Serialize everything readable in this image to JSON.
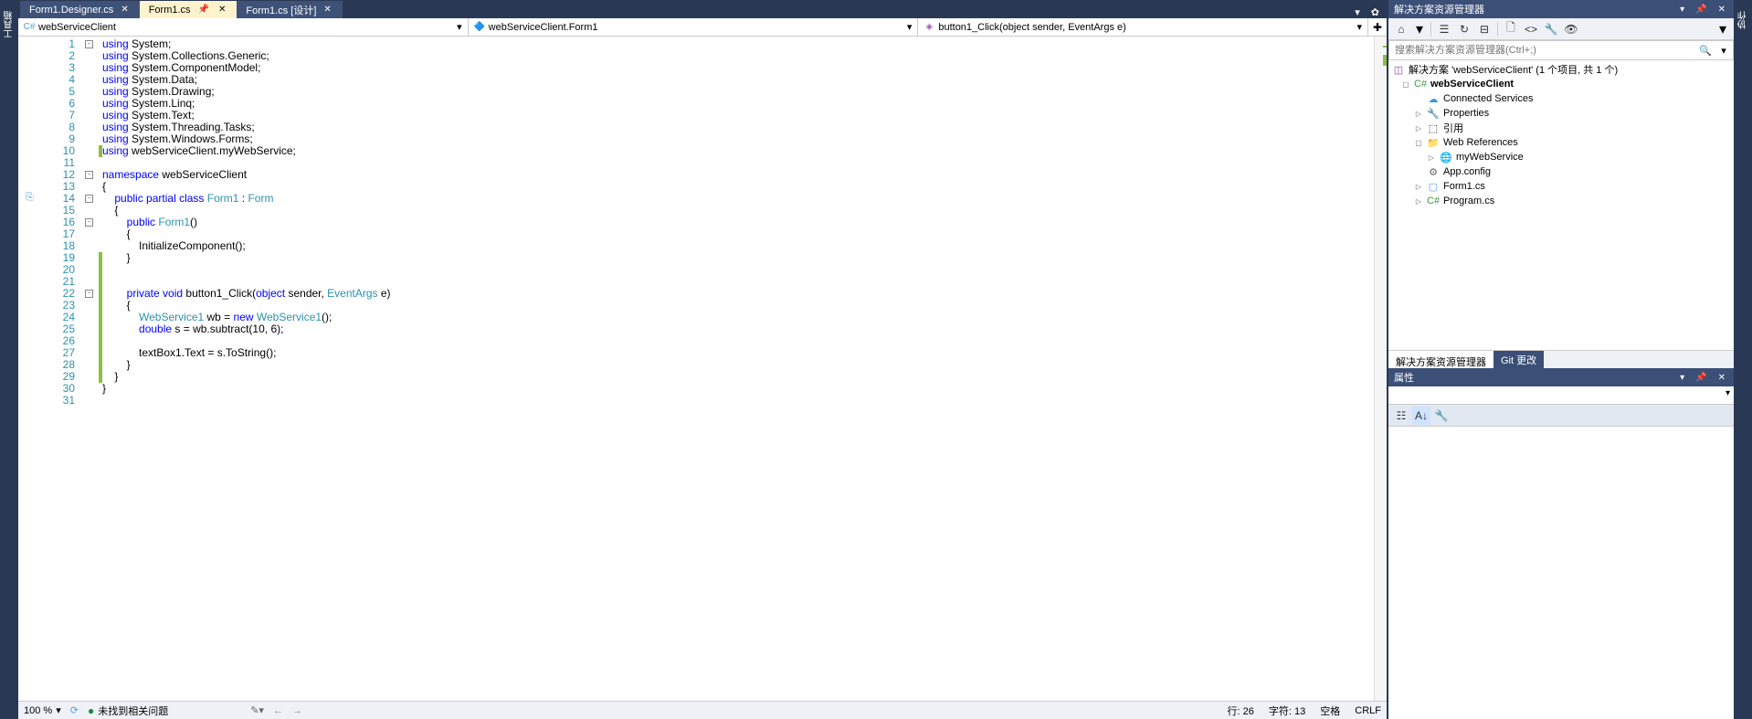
{
  "tabs": [
    {
      "label": "Form1.Designer.cs",
      "active": false
    },
    {
      "label": "Form1.cs",
      "active": true,
      "pinned": true
    },
    {
      "label": "Form1.cs [设计]",
      "active": false
    }
  ],
  "nav": {
    "scope": "webServiceClient",
    "class": "webServiceClient.Form1",
    "member": "button1_Click(object sender, EventArgs e)"
  },
  "code_lines": [
    {
      "n": 1,
      "html": "<span class='kw'>using</span> System;"
    },
    {
      "n": 2,
      "html": "<span class='kw'>using</span> System.Collections.Generic;"
    },
    {
      "n": 3,
      "html": "<span class='kw'>using</span> System.ComponentModel;"
    },
    {
      "n": 4,
      "html": "<span class='kw'>using</span> System.Data;"
    },
    {
      "n": 5,
      "html": "<span class='kw'>using</span> System.Drawing;"
    },
    {
      "n": 6,
      "html": "<span class='kw'>using</span> System.Linq;"
    },
    {
      "n": 7,
      "html": "<span class='kw'>using</span> System.Text;"
    },
    {
      "n": 8,
      "html": "<span class='kw'>using</span> System.Threading.Tasks;"
    },
    {
      "n": 9,
      "html": "<span class='kw'>using</span> System.Windows.Forms;"
    },
    {
      "n": 10,
      "html": "<span class='kw'>using</span> webServiceClient.myWebService;"
    },
    {
      "n": 11,
      "html": ""
    },
    {
      "n": 12,
      "html": "<span class='kw'>namespace</span> webServiceClient"
    },
    {
      "n": 13,
      "html": "{"
    },
    {
      "n": 14,
      "html": "    <span class='kw'>public</span> <span class='kw'>partial</span> <span class='kw'>class</span> <span class='type'>Form1</span> : <span class='type'>Form</span>"
    },
    {
      "n": 15,
      "html": "    {"
    },
    {
      "n": 16,
      "html": "        <span class='kw'>public</span> <span class='type'>Form1</span>()"
    },
    {
      "n": 17,
      "html": "        {"
    },
    {
      "n": 18,
      "html": "            InitializeComponent();"
    },
    {
      "n": 19,
      "html": "        }"
    },
    {
      "n": 20,
      "html": ""
    },
    {
      "n": 21,
      "html": ""
    },
    {
      "n": 22,
      "html": "        <span class='kw'>private</span> <span class='kw'>void</span> button1_Click(<span class='kw'>object</span> sender, <span class='type'>EventArgs</span> e)"
    },
    {
      "n": 23,
      "html": "        {"
    },
    {
      "n": 24,
      "html": "            <span class='type'>WebService1</span> wb = <span class='kw'>new</span> <span class='type'>WebService1</span>();"
    },
    {
      "n": 25,
      "html": "            <span class='kw'>double</span> s = wb.subtract(10, 6);"
    },
    {
      "n": 26,
      "html": ""
    },
    {
      "n": 27,
      "html": "            textBox1.Text = s.ToString();"
    },
    {
      "n": 28,
      "html": "        }"
    },
    {
      "n": 29,
      "html": "    }"
    },
    {
      "n": 30,
      "html": "}"
    },
    {
      "n": 31,
      "html": ""
    }
  ],
  "fold_lines": [
    1,
    12,
    14,
    16,
    22
  ],
  "change_ranges": [
    {
      "from": 10,
      "to": 10
    },
    {
      "from": 19,
      "to": 29
    }
  ],
  "status": {
    "zoom": "100 %",
    "issues": "未找到相关问题",
    "line": "行: 26",
    "char": "字符: 13",
    "space": "空格",
    "eol": "CRLF"
  },
  "solution_explorer": {
    "title": "解决方案资源管理器",
    "search_placeholder": "搜索解决方案资源管理器(Ctrl+;)",
    "root": "解决方案 'webServiceClient' (1 个项目, 共 1 个)",
    "project": "webServiceClient",
    "nodes": {
      "connected": "Connected Services",
      "properties": "Properties",
      "references": "引用",
      "webrefs": "Web References",
      "mywebservice": "myWebService",
      "appconfig": "App.config",
      "form1": "Form1.cs",
      "program": "Program.cs"
    },
    "tabs": {
      "explorer": "解决方案资源管理器",
      "git": "Git 更改"
    }
  },
  "properties": {
    "title": "属性"
  }
}
